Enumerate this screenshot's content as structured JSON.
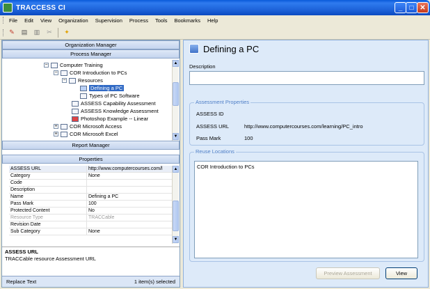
{
  "window": {
    "title": "TRACCESS CI"
  },
  "menu": [
    "File",
    "Edit",
    "View",
    "Organization",
    "Supervision",
    "Process",
    "Tools",
    "Bookmarks",
    "Help"
  ],
  "left": {
    "organization_manager": "Organization Manager",
    "process_manager": "Process Manager",
    "report_manager": "Report Manager",
    "properties_header": "Properties",
    "tree": [
      {
        "label": "Computer Training",
        "toggle": "−"
      },
      {
        "label": "COR  Introduction to PCs",
        "toggle": "−"
      },
      {
        "label": "Resources",
        "toggle": "−"
      },
      {
        "label": "Defining a PC"
      },
      {
        "label": "Types of PC Software"
      },
      {
        "label": "ASSESS Capability Assessment"
      },
      {
        "label": "ASSESS Knowledge Assessment"
      },
      {
        "label": "Photoshop Example -- Linear"
      },
      {
        "label": "COR  Microsoft Access",
        "toggle": "+"
      },
      {
        "label": "COR  Microsoft Excel",
        "toggle": "+"
      }
    ],
    "properties": [
      {
        "name": "ASSESS URL",
        "value": "http://www.computercourses.com/l"
      },
      {
        "name": "Category",
        "value": "None"
      },
      {
        "name": "Code",
        "value": ""
      },
      {
        "name": "Description",
        "value": ""
      },
      {
        "name": "Name",
        "value": "Defining a PC"
      },
      {
        "name": "Pass Mark",
        "value": "100"
      },
      {
        "name": "Protected Content",
        "value": "No"
      },
      {
        "name": "Resource Type",
        "value": "TRACCable"
      },
      {
        "name": "Revision Date",
        "value": ""
      },
      {
        "name": "Sub Category",
        "value": "None"
      }
    ],
    "description_title": "ASSESS URL",
    "description_text": "TRACCable resource Assessment URL",
    "status_button": "Replace Text",
    "status_count": "1 item(s) selected"
  },
  "right": {
    "title": "Defining a PC",
    "description_label": "Description",
    "description_value": "",
    "assessment_legend": "Assessment Properties",
    "assess_id_label": "ASSESS ID",
    "assess_id_value": "",
    "assess_url_label": "ASSESS URL",
    "assess_url_value": "http://www.computercourses.com/learning/PC_intro",
    "pass_mark_label": "Pass Mark",
    "pass_mark_value": "100",
    "reuse_legend": "Reuse Locations",
    "reuse_items": [
      "COR  Introduction to PCs"
    ],
    "preview_button": "Preview Assessment",
    "view_button": "View"
  }
}
